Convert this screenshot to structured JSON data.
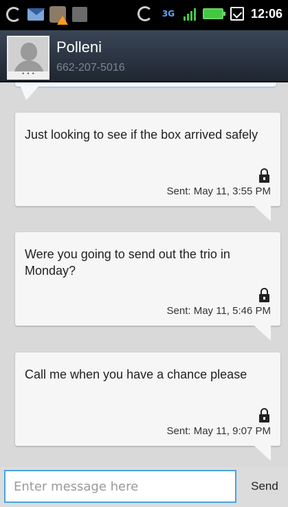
{
  "status_bar": {
    "time": "12:06",
    "left_icons": [
      "sync-icon",
      "mail-icon",
      "contact-warning-icon",
      "shopping-bag-icon"
    ],
    "right_icons": [
      "sync-icon",
      "3g-icon",
      "signal-icon",
      "battery-icon",
      "calendar-icon"
    ]
  },
  "header": {
    "contact_name": "Polleni",
    "contact_number": "662-207-5016"
  },
  "messages": [
    {
      "text": "Just looking to see if the box arrived safely",
      "sent": "Sent: May 11, 3:55 PM",
      "locked": true
    },
    {
      "text": "Were you going to send out the trio in Monday?",
      "sent": "Sent: May 11, 5:46 PM",
      "locked": true
    },
    {
      "text": "Call me when you have a chance please",
      "sent": "Sent: May 11, 9:07 PM",
      "locked": true
    }
  ],
  "composer": {
    "placeholder": "Enter message here",
    "send_label": "Send"
  },
  "colors": {
    "header_bg": "#2b3440",
    "bubble_bg": "#f6f6f6",
    "input_border": "#4aa3df",
    "battery": "#41c941"
  }
}
